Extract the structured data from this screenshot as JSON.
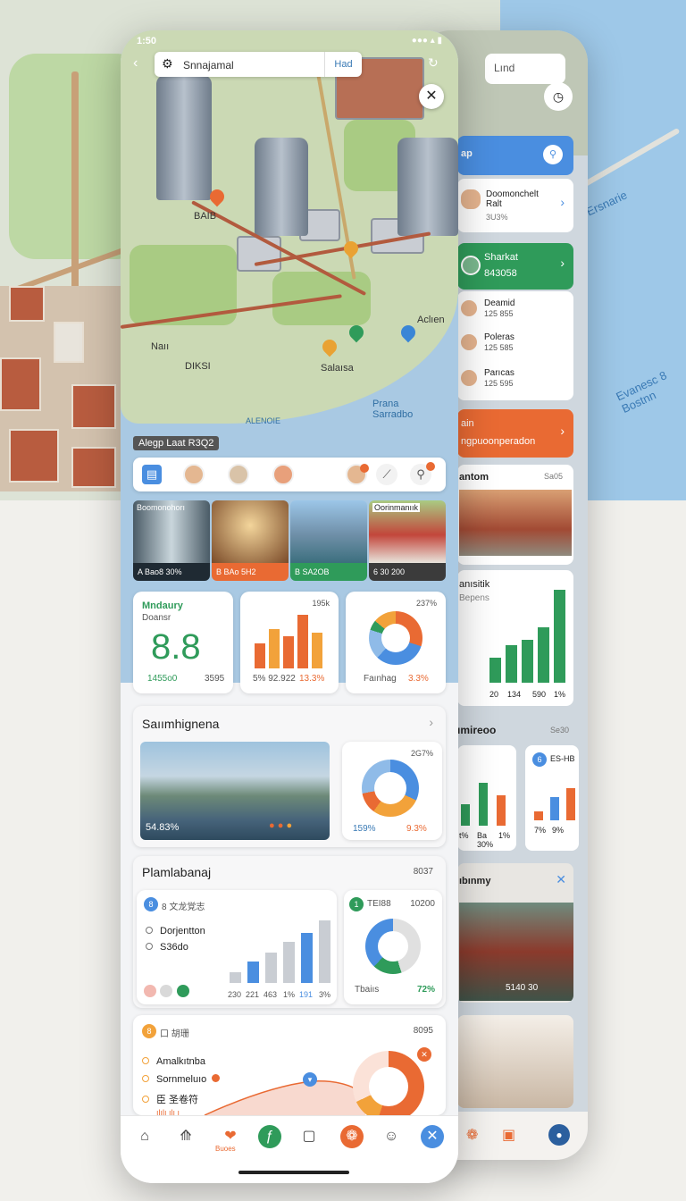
{
  "status_bar": {
    "time": "1:50",
    "signal": "●●● ▴ ▮"
  },
  "search": {
    "query": "Snnajamal",
    "action_label": "Had"
  },
  "back_search": {
    "query": "Lınd"
  },
  "map": {
    "labels": [
      "Naıı",
      "DIKSI",
      "Salaısa",
      "Aclıen",
      "Prana Sarradbo",
      "ALENOIE",
      "BAIB"
    ],
    "caption": "Alegp Laat R3Q2",
    "bg_labels": [
      "Evanesc 8 Bostnn",
      "Ersnarie"
    ]
  },
  "back_phone": {
    "blue_label": "ap",
    "person1": {
      "name": "Doomonchelt Ralt",
      "value": "3U3%"
    },
    "green_card": {
      "title": "Sharkat",
      "value": "843058"
    },
    "people": [
      {
        "name": "Deamid",
        "value": "125 855"
      },
      {
        "name": "Poleras",
        "value": "125 585"
      },
      {
        "name": "Parıcas",
        "value": "125 595"
      }
    ],
    "orange_card": {
      "title": "ain",
      "subtitle": "ngpuoonperadon"
    },
    "landmark": {
      "title": "antom",
      "tag": "Sa05"
    },
    "chart_card": {
      "title": "anısitik",
      "subtitle": "Bepens",
      "ticks": [
        "20",
        "134",
        "590",
        "1%"
      ]
    },
    "section2": {
      "title": "ımireoo",
      "tag": "Se30"
    },
    "mini1": {
      "ticks": [
        "t%",
        "Ba",
        "30%",
        "1%"
      ]
    },
    "mini2": {
      "title": "ES-HB",
      "ticks": [
        "7%",
        "9%"
      ]
    },
    "photo_card": {
      "title": "ıbınmy",
      "caption": "5140 30"
    }
  },
  "tiles": [
    {
      "title": "Boomonohorı",
      "caption": "A Bao8 30%",
      "color": "#1f2a33"
    },
    {
      "title": "",
      "caption": "B BAo 5H2",
      "color": "#e96a33"
    },
    {
      "title": "",
      "caption": "B SA2OB",
      "color": "#2f9b5a"
    },
    {
      "title": "Oorinmanıık",
      "caption": "6 30 200",
      "color": "#3b3b3b"
    }
  ],
  "stat_card": {
    "title": "Mndaury",
    "subtitle": "Doansr",
    "value": "8.8",
    "left": "1455o0",
    "right": "3595"
  },
  "bar_card": {
    "tag": "195k",
    "bottom": "5% 92.922",
    "accent": "13.3%"
  },
  "donut_card": {
    "tag": "237%",
    "label": "Faınhag",
    "accent": "3.3%"
  },
  "section1": {
    "title": "Saıımhignena",
    "photo_caption": "54.83%",
    "donut_tag": "2G7%",
    "donut_left": "159%",
    "donut_right": "9.3%"
  },
  "section2": {
    "title": "Plamlabanaj",
    "tag": "8037",
    "chart_head": "8 文龙覚志",
    "rows": [
      "Dorjentton",
      "S36do"
    ],
    "ticks": [
      "230",
      "221",
      "463",
      "1%",
      "191",
      "3%"
    ],
    "donut_head": "TEI88",
    "donut_tag": "10200",
    "donut_label": "Tbaiıs",
    "donut_accent": "72%"
  },
  "section3": {
    "head": "口 胡珊",
    "tag": "8095",
    "rows": [
      "Amalkıtnba",
      "Sornmeluıo",
      "臣 圣卷符"
    ],
    "mini_label": "ılılı ılı ı"
  },
  "tabbar": {
    "tab3_label": "Buoes"
  }
}
